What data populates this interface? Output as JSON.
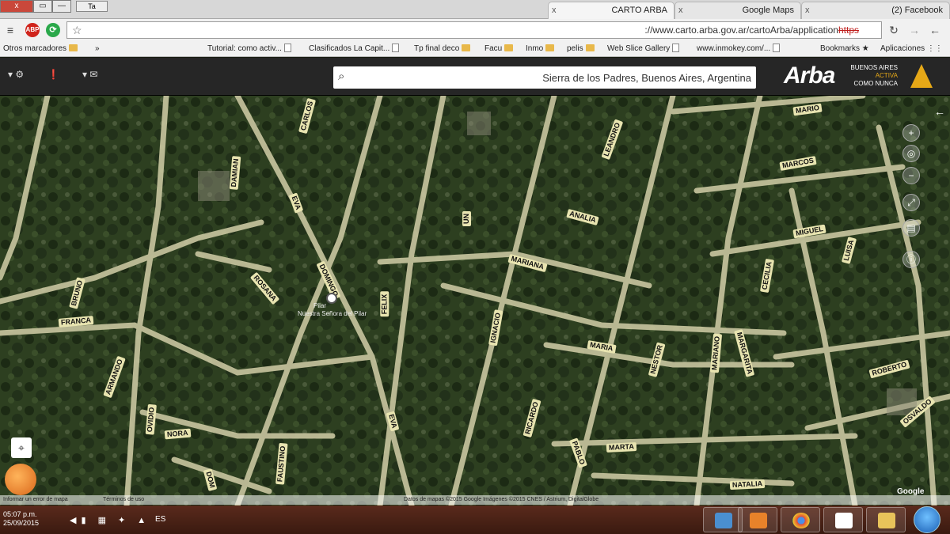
{
  "window": {
    "close_label": "x",
    "restore_label": "▭",
    "minimize_label": "—",
    "user_badge": "Ta"
  },
  "tabs": [
    {
      "label": "CARTO ARBA",
      "active": true,
      "close": "x"
    },
    {
      "label": "Google Maps",
      "active": false,
      "close": "x"
    },
    {
      "label": "(2) Facebook",
      "active": false,
      "close": "x"
    }
  ],
  "toolbar": {
    "back_icon": "arrow-left-icon",
    "url_scheme": "https",
    "url_rest": "://www.carto.arba.gov.ar/cartoArba/application",
    "ext_abp": "ABP"
  },
  "bookmarks": [
    {
      "label": "Aplicaciones",
      "icon": "apps-icon"
    },
    {
      "label": "Bookmarks",
      "icon": "star-icon"
    },
    {
      "label": "www.inmokey.com/...",
      "icon": "page-icon"
    },
    {
      "label": "Web Slice Gallery",
      "icon": "page-icon"
    },
    {
      "label": "pelis",
      "icon": "folder-icon"
    },
    {
      "label": "Inmo",
      "icon": "folder-icon"
    },
    {
      "label": "Facu",
      "icon": "folder-icon"
    },
    {
      "label": "Tp final deco",
      "icon": "folder-icon"
    },
    {
      "label": "Clasificados La Capit...",
      "icon": "page-icon"
    },
    {
      "label": "Tutorial: como activ...",
      "icon": "page-icon"
    },
    {
      "label": "»",
      "icon": ""
    },
    {
      "label": "Otros marcadores",
      "icon": "folder-icon"
    }
  ],
  "app": {
    "search_value": "Sierra de los Padres, Buenos Aires, Argentina",
    "logo_text": "Arba",
    "logo_tag_1": "BUENOS AIRES",
    "logo_tag_2": "ACTIVA",
    "logo_tag_3": "COMO NUNCA"
  },
  "map": {
    "streets": [
      {
        "name": "MARIO"
      },
      {
        "name": "MARCOS"
      },
      {
        "name": "LEANDRO"
      },
      {
        "name": "CARLOS"
      },
      {
        "name": "DAMIAN"
      },
      {
        "name": "EVA"
      },
      {
        "name": "ANALIA"
      },
      {
        "name": "MIGUEL"
      },
      {
        "name": "LUISA"
      },
      {
        "name": "CECILIA"
      },
      {
        "name": "MARIANA"
      },
      {
        "name": "ROSANA"
      },
      {
        "name": "DOMINGO"
      },
      {
        "name": "FELIX"
      },
      {
        "name": "BRUNO"
      },
      {
        "name": "FRANCA"
      },
      {
        "name": "IGNACIO"
      },
      {
        "name": "MARIA"
      },
      {
        "name": "NESTOR"
      },
      {
        "name": "MARIANO"
      },
      {
        "name": "MARGARITA"
      },
      {
        "name": "ROBERTO"
      },
      {
        "name": "ARMANDO"
      },
      {
        "name": "OVIDIO"
      },
      {
        "name": "NORA"
      },
      {
        "name": "RICARDO"
      },
      {
        "name": "EVA"
      },
      {
        "name": "PABLO"
      },
      {
        "name": "MARTA"
      },
      {
        "name": "NATALIA"
      },
      {
        "name": "FAUSTINO"
      },
      {
        "name": "OSVALDO"
      },
      {
        "name": "DOM"
      },
      {
        "name": "UN"
      }
    ],
    "poi_name": "Nuestra Señora del Pilar",
    "poi_short": "Pilar",
    "attribution_1": "Datos de mapas ©2015 Google Imágenes ©2015 CNES / Astrium, DigitalGlobe",
    "attribution_2": "Términos de uso",
    "attribution_3": "Informar un error de mapa",
    "google_badge": "Google"
  },
  "taskbar": {
    "time": "05:07 p.m.",
    "date": "25/09/2015",
    "lang": "ES"
  }
}
